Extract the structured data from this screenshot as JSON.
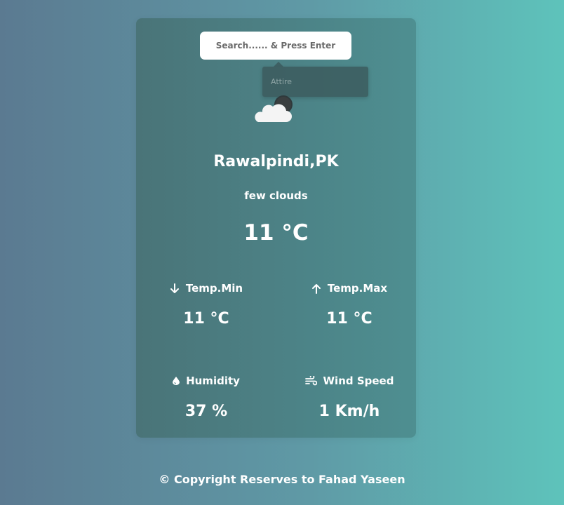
{
  "search": {
    "placeholder": "Search...... & Press Enter",
    "suggestion": "Attire"
  },
  "weather": {
    "icon": "cloud-moon-icon",
    "city": "Rawalpindi,PK",
    "description": "few clouds",
    "temperature": "11 °C"
  },
  "stats": {
    "temp_min": {
      "icon": "arrow-down-icon",
      "label": "Temp.Min",
      "value": "11 °C"
    },
    "temp_max": {
      "icon": "arrow-up-icon",
      "label": "Temp.Max",
      "value": "11 °C"
    },
    "humidity": {
      "icon": "droplet-icon",
      "label": "Humidity",
      "value": "37 %"
    },
    "wind": {
      "icon": "wind-icon",
      "label": "Wind Speed",
      "value": "1 Km/h"
    }
  },
  "footer": {
    "text": "© Copyright Reserves to Fahad Yaseen"
  },
  "colors": {
    "card": "#4c8286",
    "background_left": "#5b7a91",
    "background_right": "#5ec3bb",
    "text": "#ffffff"
  }
}
